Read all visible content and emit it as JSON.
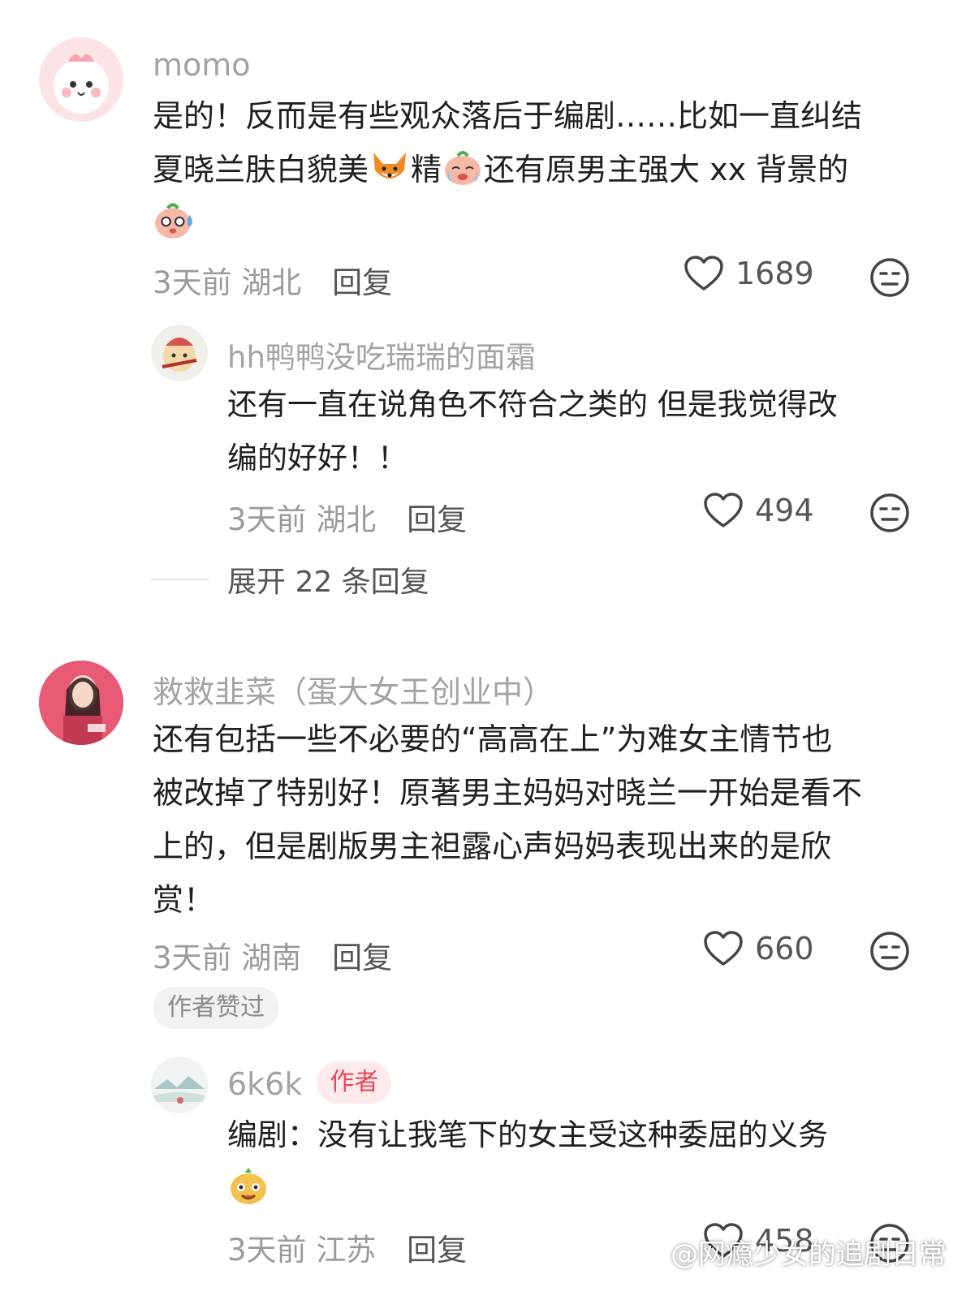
{
  "comments": [
    {
      "user": "momo",
      "text_line1": "是的！反而是有些观众落后于编剧……比如一直纠结",
      "text_line2_a": "夏晓兰肤白貌美",
      "text_line2_b": "精",
      "text_line2_c": "还有原男主强大 xx 背景的",
      "time": "3天前",
      "location": "湖北",
      "reply_label": "回复",
      "likes": "1689",
      "replies": [
        {
          "user": "hh鸭鸭没吃瑞瑞的面霜",
          "text_line1": "还有一直在说角色不符合之类的 但是我觉得改",
          "text_line2": "编的好好！！",
          "time": "3天前",
          "location": "湖北",
          "reply_label": "回复",
          "likes": "494"
        }
      ],
      "expand_label": "展开 22 条回复"
    },
    {
      "user": "救救韭菜（蛋大女王创业中）",
      "text_line1": "还有包括一些不必要的“高高在上”为难女主情节也",
      "text_line2": "被改掉了特别好！原著男主妈妈对晓兰一开始是看不",
      "text_line3": "上的，但是剧版男主袒露心声妈妈表现出来的是欣",
      "text_line4": "赏！",
      "time": "3天前",
      "location": "湖南",
      "reply_label": "回复",
      "likes": "660",
      "liked_badge": "作者赞过",
      "replies": [
        {
          "user": "6k6k",
          "badge": "作者",
          "text_line1": "编剧：没有让我笔下的女主受这种委屈的义务",
          "time": "3天前",
          "location": "江苏",
          "reply_label": "回复",
          "likes": "458"
        }
      ]
    }
  ],
  "watermark": "@网瘾少女的追剧日常",
  "colors": {
    "meta": "#9a9a9a",
    "author_badge": "#e8455a",
    "username": "#a3a3a3"
  },
  "icons": [
    "heart-icon",
    "neutral-face-icon",
    "fox-emoji",
    "crying-face-emoji",
    "sweat-face-emoji",
    "smile-face-emoji"
  ]
}
